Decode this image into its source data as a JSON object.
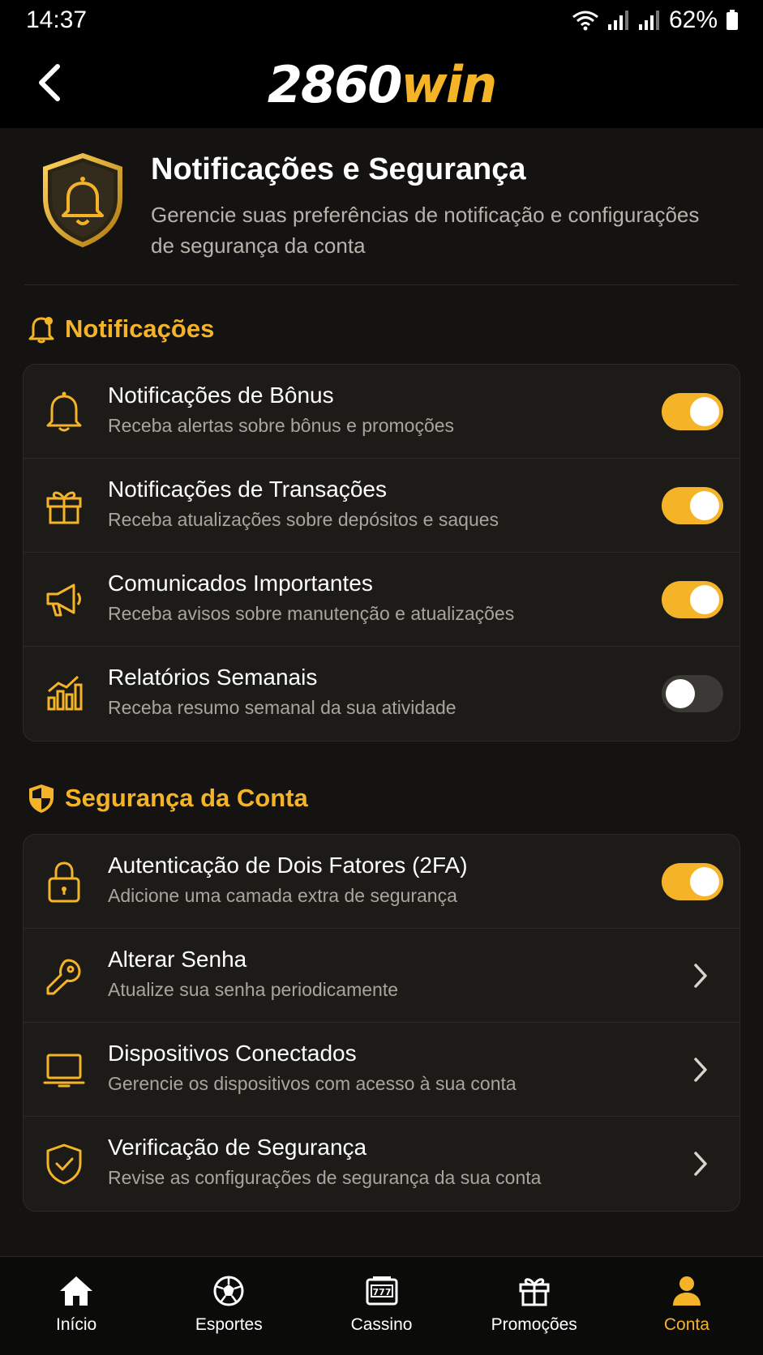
{
  "status": {
    "time": "14:37",
    "battery": "62%"
  },
  "header": {
    "logo_part1": "2860",
    "logo_part2": "win"
  },
  "page": {
    "title": "Notificações e Segurança",
    "subtitle": "Gerencie suas preferências de notificação e configurações de segurança da conta"
  },
  "notifications": {
    "section_title": "Notificações",
    "items": [
      {
        "title": "Notificações de Bônus",
        "subtitle": "Receba alertas sobre bônus e promoções",
        "enabled": true,
        "icon": "bell-icon"
      },
      {
        "title": "Notificações de Transações",
        "subtitle": "Receba atualizações sobre depósitos e saques",
        "enabled": true,
        "icon": "gift-icon"
      },
      {
        "title": "Comunicados Importantes",
        "subtitle": "Receba avisos sobre manutenção e atualizações",
        "enabled": true,
        "icon": "megaphone-icon"
      },
      {
        "title": "Relatórios Semanais",
        "subtitle": "Receba resumo semanal da sua atividade",
        "enabled": false,
        "icon": "bar-chart-icon"
      }
    ]
  },
  "security": {
    "section_title": "Segurança da Conta",
    "items": [
      {
        "title": "Autenticação de Dois Fatores (2FA)",
        "subtitle": "Adicione uma camada extra de segurança",
        "enabled": true,
        "icon": "lock-icon"
      },
      {
        "title": "Alterar Senha",
        "subtitle": "Atualize sua senha periodicamente",
        "icon": "key-icon"
      },
      {
        "title": "Dispositivos Conectados",
        "subtitle": "Gerencie os dispositivos com acesso à sua conta",
        "icon": "laptop-icon"
      },
      {
        "title": "Verificação de Segurança",
        "subtitle": "Revise as configurações de segurança da sua conta",
        "icon": "shield-check-icon"
      }
    ]
  },
  "nav": {
    "items": [
      {
        "label": "Início",
        "icon": "home-icon"
      },
      {
        "label": "Esportes",
        "icon": "soccer-ball-icon"
      },
      {
        "label": "Cassino",
        "icon": "slot-machine-icon"
      },
      {
        "label": "Promoções",
        "icon": "gift-icon"
      },
      {
        "label": "Conta",
        "icon": "user-icon",
        "active": true
      }
    ]
  },
  "colors": {
    "accent": "#f5b428",
    "background": "#141311",
    "card": "#1c1b18"
  }
}
